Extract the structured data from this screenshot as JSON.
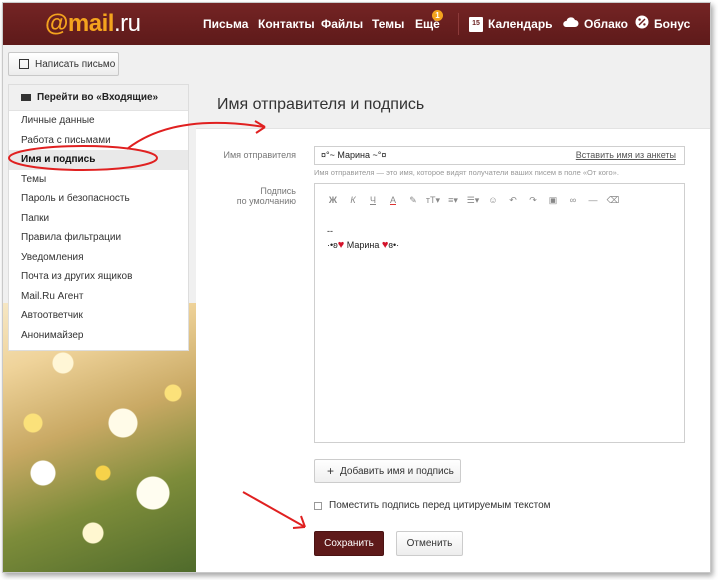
{
  "topbar": {
    "logo_at": "@",
    "logo_mail": "mail",
    "logo_ru": ".ru",
    "nav": [
      "Письма",
      "Контакты",
      "Файлы",
      "Темы",
      "Ещё"
    ],
    "more_badge": "1",
    "calendar_day": "15",
    "calendar": "Календарь",
    "cloud": "Облако",
    "bonus": "Бонус"
  },
  "sidebar": {
    "compose": "Написать письмо",
    "inbox_link": "Перейти во «Входящие»",
    "items": [
      "Личные данные",
      "Работа с письмами",
      "Имя и подпись",
      "Темы",
      "Пароль и безопасность",
      "Папки",
      "Правила фильтрации",
      "Уведомления",
      "Почта из других ящиков",
      "Mail.Ru Агент",
      "Автоответчик",
      "Анонимайзер"
    ],
    "selected_index": 2
  },
  "main": {
    "title": "Имя отправителя и подпись",
    "sender_label": "Имя отправителя",
    "sender_value": "¤°~ Марина ~°¤",
    "insert_link": "Вставить имя из анкеты",
    "hint": "Имя отправителя — это имя, которое видят получатели ваших писем в поле «От кого».",
    "signature_label_1": "Подпись",
    "signature_label_2": "по умолчанию",
    "signature_dash": "--",
    "signature_pre": "·•ʚ",
    "signature_name": " Марина ",
    "signature_post": "ɞ•·",
    "add_button": "Добавить имя и подпись",
    "checkbox_label": "Поместить подпись перед цитируемым текстом",
    "checkbox_checked": false,
    "save": "Сохранить",
    "cancel": "Отменить"
  },
  "colors": {
    "brand": "#6a1f1f",
    "accent": "#f4a31e",
    "arrow": "#e02020"
  }
}
